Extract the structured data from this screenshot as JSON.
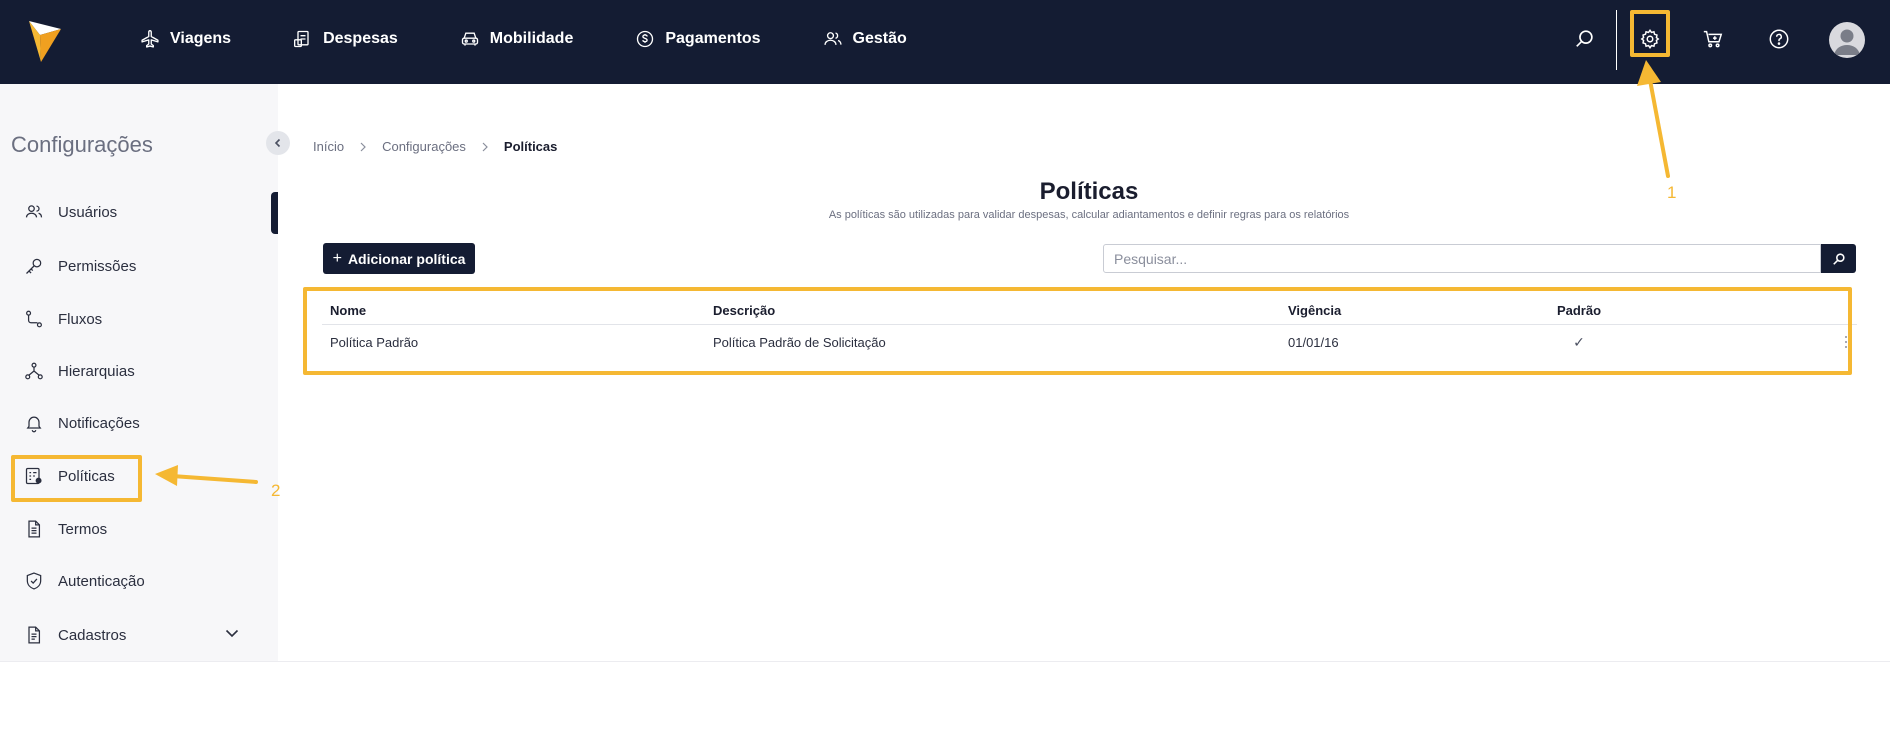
{
  "nav": {
    "items": [
      {
        "label": "Viagens",
        "icon": "airplane-icon"
      },
      {
        "label": "Despesas",
        "icon": "receipt-icon"
      },
      {
        "label": "Mobilidade",
        "icon": "car-icon"
      },
      {
        "label": "Pagamentos",
        "icon": "dollar-circle-icon"
      },
      {
        "label": "Gestão",
        "icon": "users-icon"
      }
    ]
  },
  "sidebar": {
    "title": "Configurações",
    "items": [
      {
        "label": "Usuários",
        "icon": "users-icon"
      },
      {
        "label": "Permissões",
        "icon": "key-icon"
      },
      {
        "label": "Fluxos",
        "icon": "flow-icon"
      },
      {
        "label": "Hierarquias",
        "icon": "hierarchy-icon"
      },
      {
        "label": "Notificações",
        "icon": "bell-icon"
      },
      {
        "label": "Políticas",
        "icon": "policy-icon"
      },
      {
        "label": "Termos",
        "icon": "document-icon"
      },
      {
        "label": "Autenticação",
        "icon": "shield-check-icon"
      },
      {
        "label": "Cadastros",
        "icon": "document-list-icon"
      }
    ]
  },
  "breadcrumb": [
    "Início",
    "Configurações",
    "Políticas"
  ],
  "page": {
    "title": "Políticas",
    "subtitle": "As políticas são utilizadas para validar despesas, calcular adiantamentos e definir regras para os relatórios",
    "add_button": "Adicionar política",
    "search_placeholder": "Pesquisar..."
  },
  "table": {
    "headers": [
      "Nome",
      "Descrição",
      "Vigência",
      "Padrão"
    ],
    "rows": [
      {
        "nome": "Política Padrão",
        "descricao": "Política Padrão de Solicitação",
        "vigencia": "01/01/16",
        "padrao": "✓"
      }
    ]
  },
  "annotations": {
    "one": "1",
    "two": "2"
  },
  "colors": {
    "navbar": "#141c33",
    "annotation": "#f5b833",
    "sidebar_bg": "#f7f7f9"
  }
}
